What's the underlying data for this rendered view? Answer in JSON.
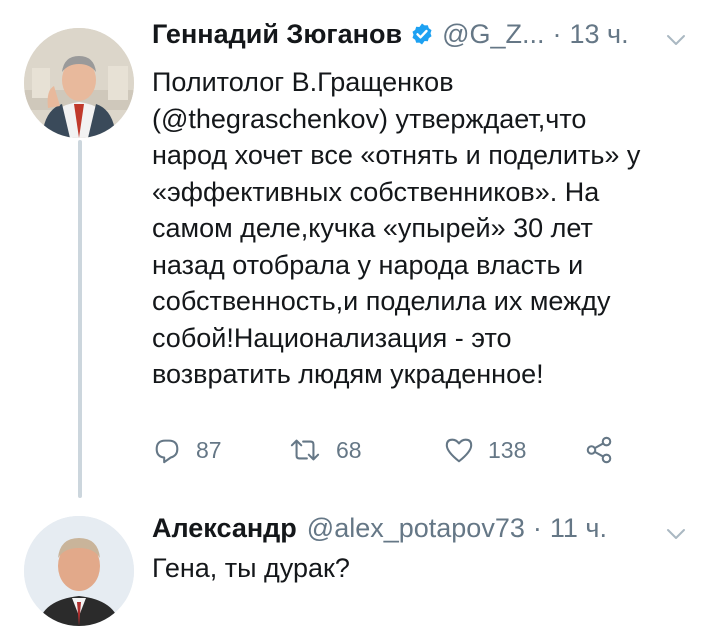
{
  "tweet": {
    "author_name": "Геннадий Зюганов",
    "verified": true,
    "handle": "@G_Z...",
    "separator": "·",
    "time": "13 ч.",
    "text_lines": [
      "Политолог В.Гращенков",
      "(@thegraschenkov) утверждает,что",
      "народ хочет все «отнять и поделить» у",
      "«эффективных собственников». На",
      "самом деле,кучка «упырей» 30 лет",
      "назад отобрала у народа власть и",
      "собственность,и поделила их между",
      "собой!Национализация - это",
      "возвратить людям украденное!"
    ],
    "replies_count": "87",
    "retweets_count": "68",
    "likes_count": "138"
  },
  "reply": {
    "author_name": "Александр",
    "handle": "@alex_potapov73",
    "separator": "·",
    "time": "11 ч.",
    "text": "Гена, ты дурак?"
  },
  "icons": {
    "verified": "verified-badge-icon",
    "more": "chevron-down-icon",
    "reply": "reply-icon",
    "retweet": "retweet-icon",
    "like": "heart-icon",
    "share": "share-icon"
  },
  "colors": {
    "text": "#14171a",
    "secondary": "#657786",
    "verified_blue": "#1da1f2",
    "thread_line": "#ccd6dd"
  }
}
